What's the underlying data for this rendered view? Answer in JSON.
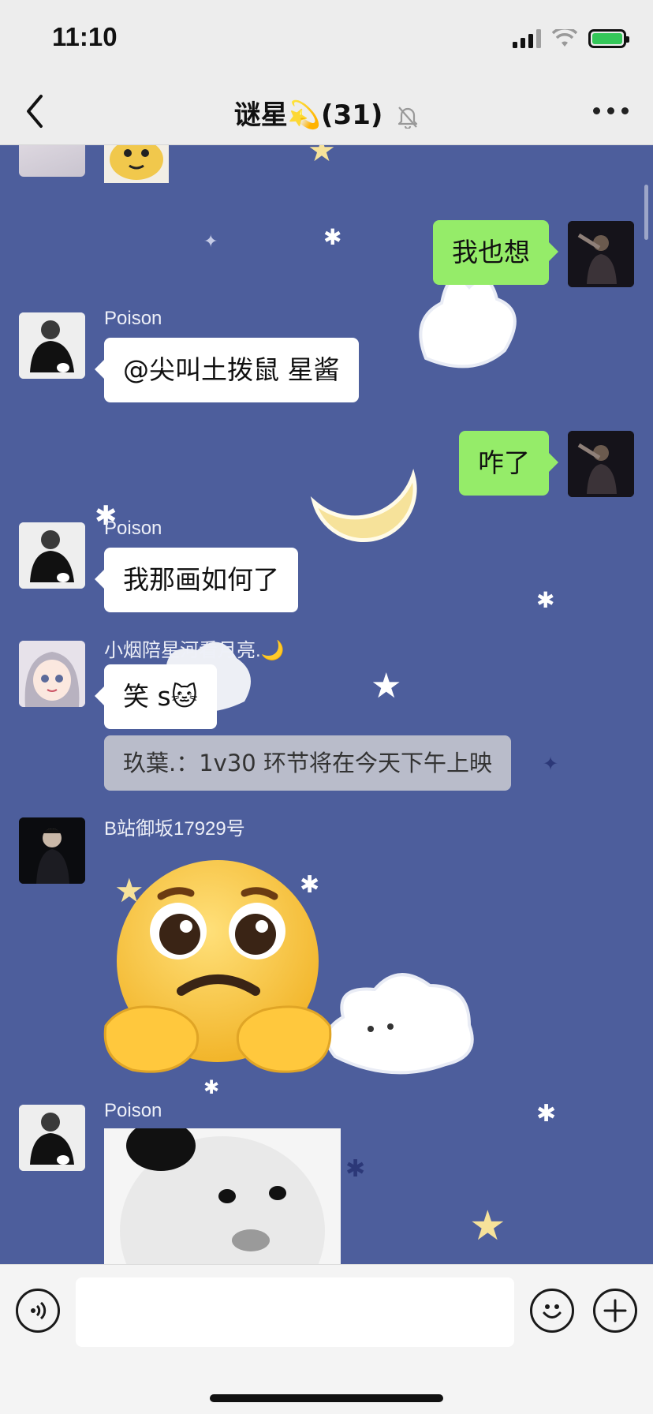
{
  "status_bar": {
    "time": "11:10"
  },
  "nav": {
    "title": "谜星💫(31)"
  },
  "messages": [
    {
      "sender": "",
      "direction": "out",
      "text": "我也想"
    },
    {
      "sender": "Poison",
      "direction": "in",
      "text": "@尖叫土拨鼠 星酱"
    },
    {
      "sender": "",
      "direction": "out",
      "text": "咋了"
    },
    {
      "sender": "Poison",
      "direction": "in",
      "text": "我那画如何了"
    },
    {
      "sender": "小烟陪星河看月亮.🌙",
      "direction": "in",
      "text": "笑 s🐱",
      "quote": "玖葉.：1v30 环节将在今天下午上映"
    },
    {
      "sender": "B站御坂17929号",
      "direction": "in",
      "text": "🥺"
    },
    {
      "sender": "Poison",
      "direction": "in",
      "text": ""
    }
  ],
  "icons": {
    "back": "chevron-left-icon",
    "mute": "bell-slash-icon",
    "more": "more-dots-icon",
    "voice": "voice-icon",
    "emoji": "emoji-icon",
    "plus": "plus-icon"
  },
  "colors": {
    "chat_background": "#4d5e9c",
    "outgoing_bubble": "#95ec69",
    "incoming_bubble": "#ffffff"
  }
}
